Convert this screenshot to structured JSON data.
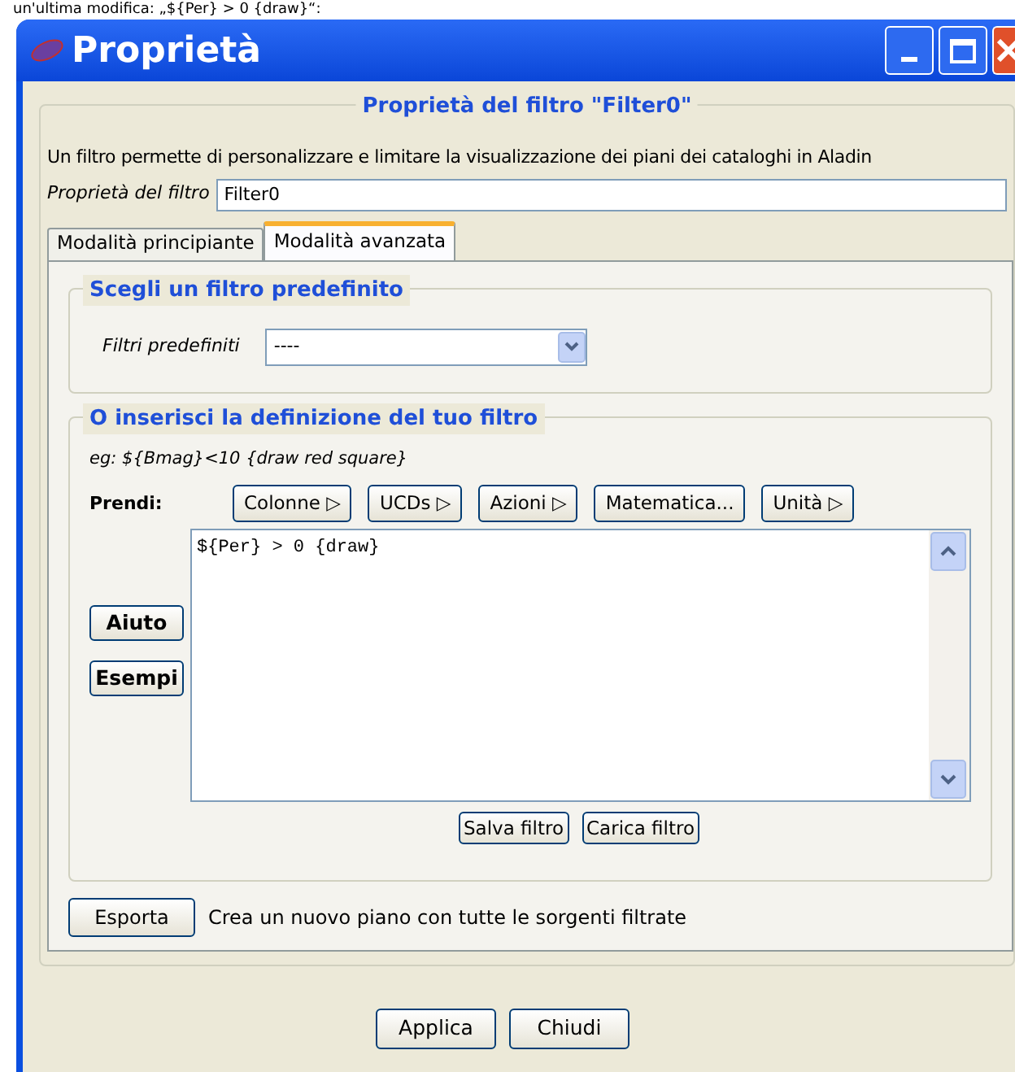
{
  "document_text": "un'ultima modifica: „${Per} > 0 {draw}“:",
  "window": {
    "title": "Proprietà"
  },
  "panel_title": "Proprietà del filtro \"Filter0\"",
  "description": "Un filtro permette di personalizzare e limitare la visualizzazione dei piani dei cataloghi in Aladin",
  "name_field": {
    "label": "Proprietà del filtro",
    "value": "Filter0"
  },
  "tabs": [
    {
      "label": "Modalità principiante",
      "selected": false
    },
    {
      "label": "Modalità avanzata",
      "selected": true
    }
  ],
  "predefined": {
    "title": "Scegli un filtro predefinito",
    "label": "Filtri predefiniti",
    "value": "----"
  },
  "definition": {
    "title": "O inserisci la definizione del tuo filtro",
    "example": "eg: ${Bmag}<10 {draw red square}",
    "pick_label": "Prendi:",
    "menus": [
      {
        "label": "Colonne",
        "arrow": "▷"
      },
      {
        "label": "UCDs",
        "arrow": "▷"
      },
      {
        "label": "Azioni",
        "arrow": "▷"
      },
      {
        "label": "Matematica..."
      },
      {
        "label": "Unità",
        "arrow": "▷"
      }
    ],
    "side_buttons": [
      "Aiuto",
      "Esempi"
    ],
    "editor_value": "${Per} > 0 {draw}",
    "file_buttons": [
      "Salva filtro",
      "Carica filtro"
    ]
  },
  "export": {
    "button": "Esporta",
    "text": "Crea un nuovo piano con tutte le sorgenti filtrate"
  },
  "buttons": [
    "Applica",
    "Chiudi"
  ]
}
